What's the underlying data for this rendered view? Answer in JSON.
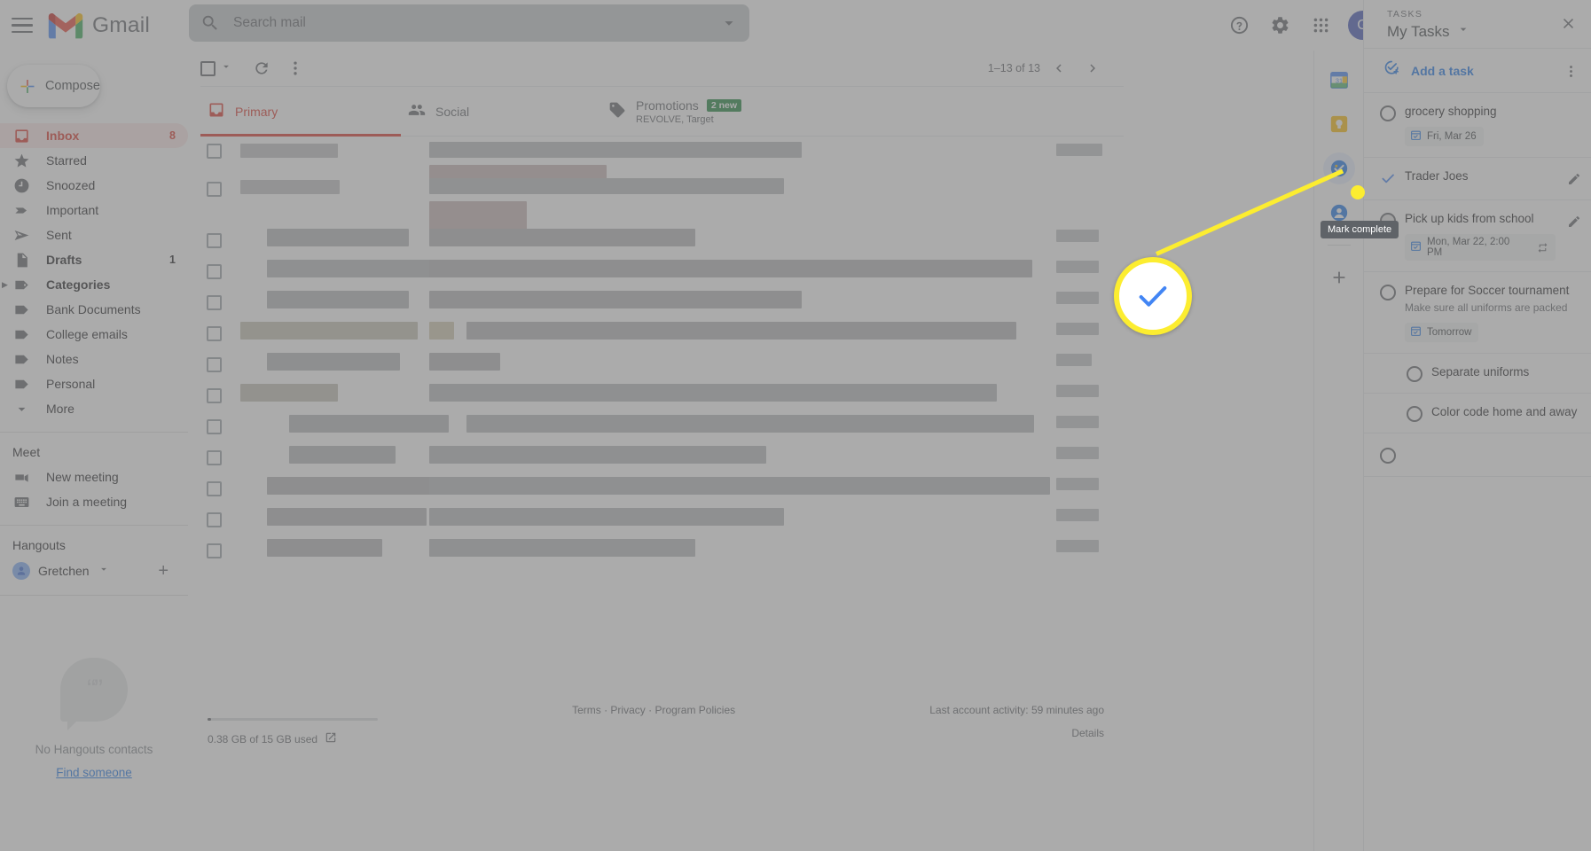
{
  "header": {
    "app_name": "Gmail",
    "menu_icon": "hamburger-icon",
    "search": {
      "placeholder": "Search mail",
      "value": "",
      "icon": "search-icon",
      "options_icon": "chevron-down-icon"
    },
    "help_label": "Support",
    "settings_label": "Settings",
    "apps_label": "Google apps",
    "avatar_initial": "G"
  },
  "sidebar": {
    "compose_label": "Compose",
    "items": [
      {
        "label": "Inbox",
        "count": "8",
        "icon": "inbox-icon",
        "active": true,
        "bold": true
      },
      {
        "label": "Starred",
        "count": "",
        "icon": "star-icon",
        "active": false,
        "bold": false
      },
      {
        "label": "Snoozed",
        "count": "",
        "icon": "clock-icon",
        "active": false,
        "bold": false
      },
      {
        "label": "Important",
        "count": "",
        "icon": "important-label-icon",
        "active": false,
        "bold": false
      },
      {
        "label": "Sent",
        "count": "",
        "icon": "send-icon",
        "active": false,
        "bold": false
      },
      {
        "label": "Drafts",
        "count": "1",
        "icon": "draft-icon",
        "active": false,
        "bold": true
      },
      {
        "label": "Categories",
        "count": "",
        "icon": "tag-icon",
        "active": false,
        "bold": true,
        "expandable": true
      },
      {
        "label": "Bank Documents",
        "count": "",
        "icon": "tag-icon",
        "active": false,
        "bold": false
      },
      {
        "label": "College emails",
        "count": "",
        "icon": "tag-icon",
        "active": false,
        "bold": false
      },
      {
        "label": "Notes",
        "count": "",
        "icon": "tag-icon",
        "active": false,
        "bold": false
      },
      {
        "label": "Personal",
        "count": "",
        "icon": "tag-icon",
        "active": false,
        "bold": false
      },
      {
        "label": "More",
        "count": "",
        "icon": "chevron-down-icon",
        "active": false,
        "bold": false
      }
    ],
    "meet": {
      "title": "Meet",
      "items": [
        {
          "label": "New meeting",
          "icon": "video-camera-icon"
        },
        {
          "label": "Join a meeting",
          "icon": "keyboard-icon"
        }
      ]
    },
    "hangouts": {
      "title": "Hangouts",
      "user": "Gretchen",
      "add_label": "+",
      "empty_text": "No Hangouts contacts",
      "find_link": "Find someone"
    }
  },
  "mail": {
    "toolbar": {
      "select_all_icon": "checkbox-icon",
      "select_caret_icon": "chevron-down-icon",
      "refresh_icon": "refresh-icon",
      "more_icon": "more-vertical-icon"
    },
    "pagination": {
      "range": "1–13 of 13",
      "prev_icon": "chevron-left-icon",
      "next_icon": "chevron-right-icon"
    },
    "tabs": [
      {
        "label": "Primary",
        "icon": "inbox-icon",
        "active": true,
        "badge": "",
        "sub": ""
      },
      {
        "label": "Social",
        "icon": "people-icon",
        "active": false,
        "badge": "",
        "sub": ""
      },
      {
        "label": "Promotions",
        "icon": "tag-icon",
        "active": false,
        "badge": "2 new",
        "sub": "REVOLVE, Target"
      }
    ],
    "footer": {
      "storage_text": "0.38 GB of 15 GB used",
      "storage_icon": "external-link-icon",
      "links": [
        "Terms",
        "Privacy",
        "Program Policies"
      ],
      "separator": "·",
      "last_activity": "Last account activity: 59 minutes ago",
      "details_label": "Details"
    }
  },
  "app_strip": {
    "items": [
      {
        "name": "google-calendar-icon",
        "label": "Calendar",
        "selected": false
      },
      {
        "name": "google-keep-icon",
        "label": "Keep",
        "selected": false
      },
      {
        "name": "google-tasks-icon",
        "label": "Tasks",
        "selected": true
      },
      {
        "name": "google-contacts-icon",
        "label": "Contacts",
        "selected": false
      }
    ],
    "add_label": "+",
    "add_icon": "plus-icon"
  },
  "tasks": {
    "eyebrow": "TASKS",
    "list_name": "My Tasks",
    "list_caret_icon": "chevron-down-icon",
    "close_icon": "close-icon",
    "add_task_label": "Add a task",
    "add_task_icon": "add-task-icon",
    "more_icon": "more-vertical-icon",
    "tooltip": "Mark complete",
    "items": [
      {
        "title": "grocery shopping",
        "note": "",
        "chip": "Fri, Mar 26",
        "chip_icon": "calendar-icon",
        "completed": false,
        "hovered": false,
        "subtask": false,
        "has_edit": false,
        "repeat": false
      },
      {
        "title": "Trader Joes",
        "note": "",
        "chip": "",
        "chip_icon": "",
        "completed": true,
        "hovered": false,
        "subtask": false,
        "has_edit": true,
        "repeat": false
      },
      {
        "title": "Pick up kids from school",
        "note": "",
        "chip": "Mon, Mar 22, 2:00 PM",
        "chip_icon": "calendar-icon",
        "completed": false,
        "hovered": true,
        "subtask": false,
        "has_edit": true,
        "repeat": true,
        "repeat_icon": "repeat-icon"
      },
      {
        "title": "Prepare for Soccer tournament",
        "note": "Make sure all uniforms are packed",
        "chip": "Tomorrow",
        "chip_icon": "calendar-icon",
        "completed": false,
        "hovered": false,
        "subtask": false,
        "has_edit": false,
        "repeat": false
      },
      {
        "title": "Separate uniforms",
        "note": "",
        "chip": "",
        "chip_icon": "",
        "completed": false,
        "hovered": false,
        "subtask": true,
        "has_edit": false,
        "repeat": false
      },
      {
        "title": "Color code home and away",
        "note": "",
        "chip": "",
        "chip_icon": "",
        "completed": false,
        "hovered": false,
        "subtask": true,
        "has_edit": false,
        "repeat": false
      }
    ]
  },
  "callout": {
    "magnified_icon": "blue-checkmark-icon",
    "highlight_color": "#fced30",
    "accent_color": "#1a73e8"
  },
  "colors": {
    "gmail_red": "#d93025",
    "google_blue": "#1a73e8",
    "green_badge": "#188038",
    "avatar_bg": "#3f51b5",
    "highlight_yellow": "#fced30"
  }
}
